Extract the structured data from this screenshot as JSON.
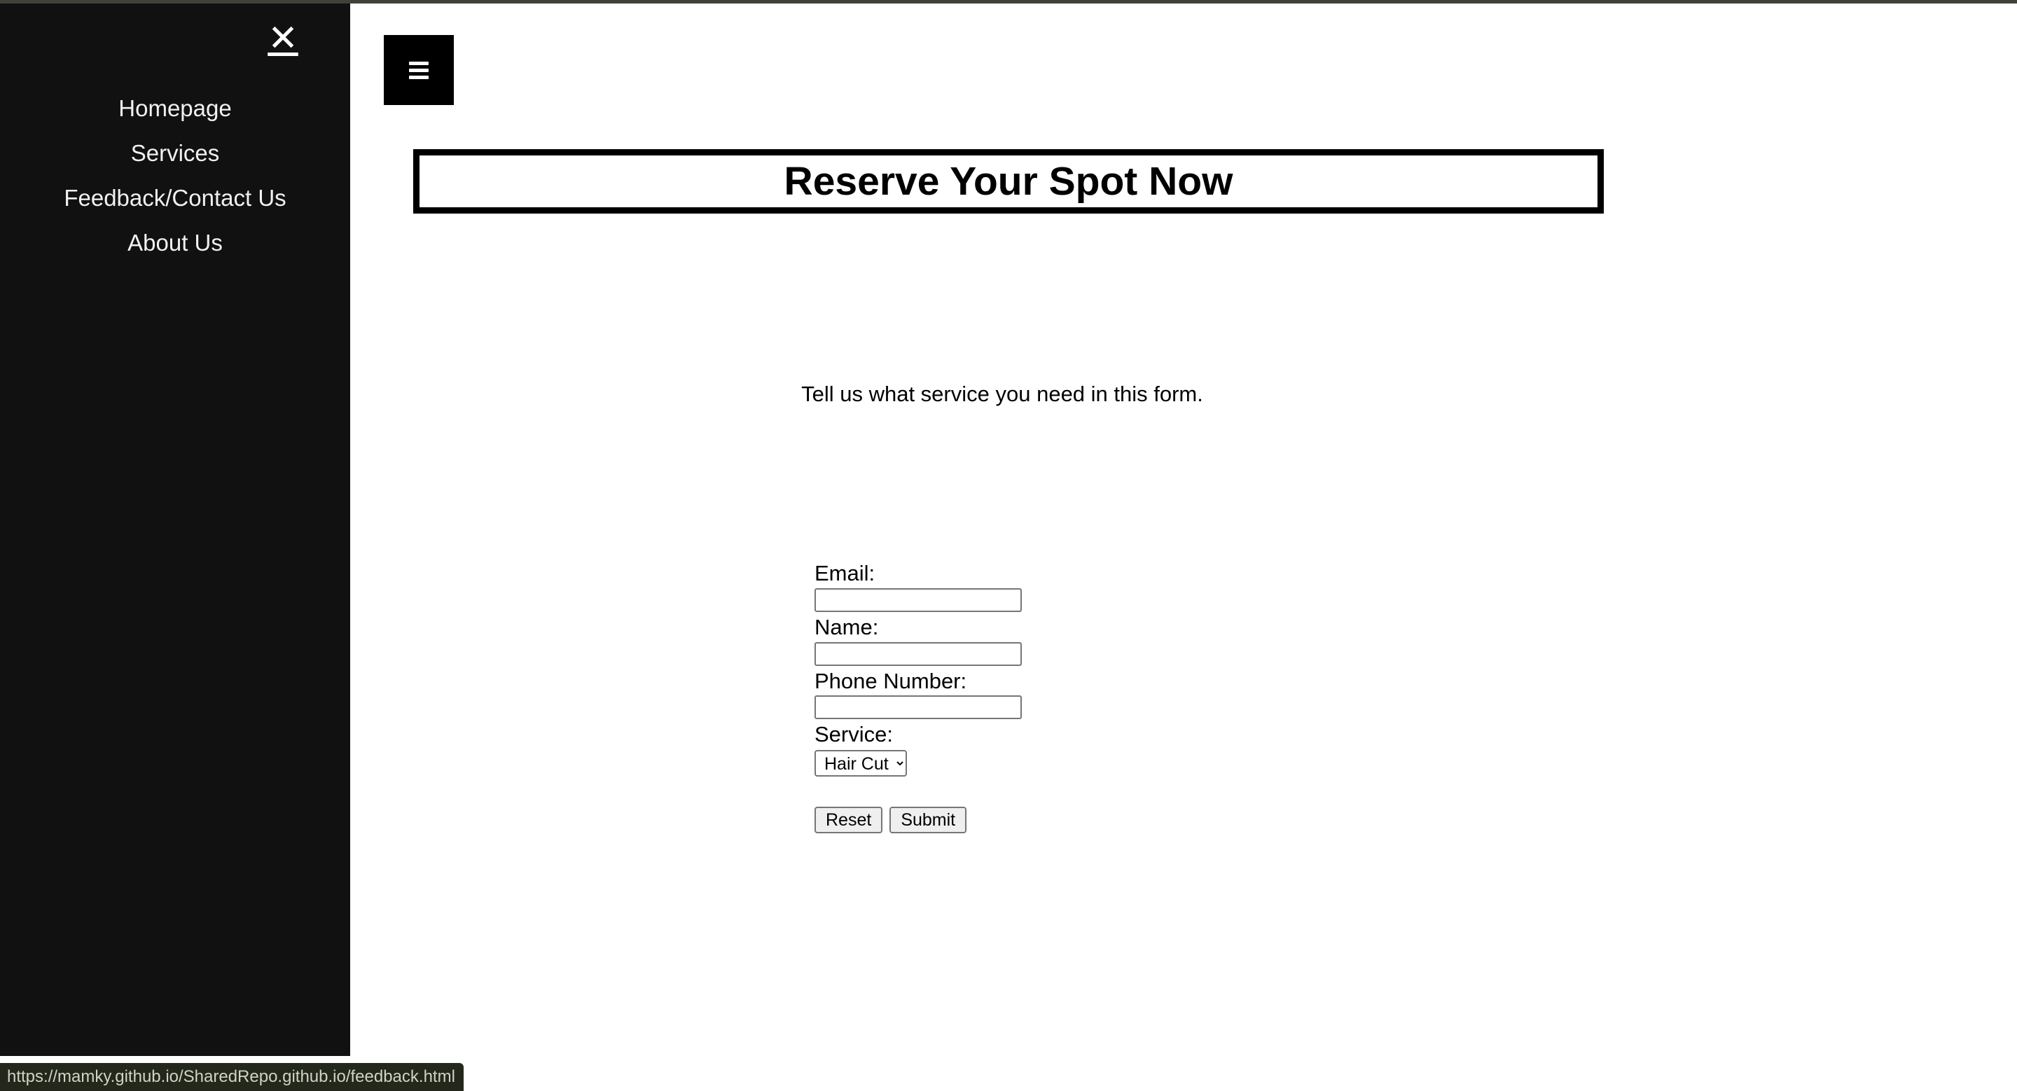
{
  "browser": {
    "status_bar_url": "https://mamky.github.io/SharedRepo.github.io/feedback.html"
  },
  "sidenav": {
    "close_label": "✕",
    "close_icon": "close-x-icon",
    "items": [
      {
        "label": "Homepage"
      },
      {
        "label": "Services"
      },
      {
        "label": "Feedback/Contact Us"
      },
      {
        "label": "About Us"
      }
    ]
  },
  "main": {
    "open_nav_icon": "hamburger-menu-icon",
    "open_nav_label": "☰",
    "title": "Reserve Your Spot Now",
    "intro": "Tell us what service you need in this form."
  },
  "form": {
    "fields": [
      {
        "label": "Email:",
        "value": "",
        "placeholder": ""
      },
      {
        "label": "Name:",
        "value": "",
        "placeholder": ""
      },
      {
        "label": "Phone Number:",
        "value": "",
        "placeholder": ""
      }
    ],
    "service": {
      "label": "Service:",
      "selected": "Hair Cut",
      "options": [
        "Hair Cut"
      ]
    },
    "reset_label": "Reset",
    "submit_label": "Submit"
  },
  "colors": {
    "sidenav_background": "#111111",
    "menu_button_background": "#000000",
    "page_background": "#ffffff",
    "title_border": "#000000",
    "status_bar_background": "#23271c",
    "status_bar_text": "#cdd5c1",
    "browser_strip": "#40423a"
  }
}
